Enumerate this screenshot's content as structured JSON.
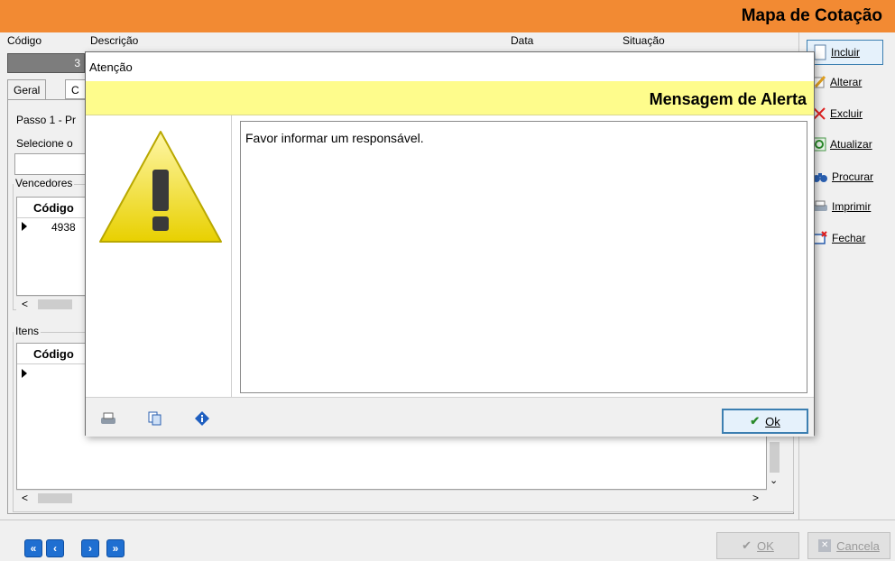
{
  "window": {
    "title": "Mapa de Cotação"
  },
  "header_fields": {
    "codigo_label": "Código",
    "codigo_value": "3",
    "descricao_label": "Descrição",
    "data_label": "Data",
    "situacao_label": "Situação"
  },
  "tabs": [
    {
      "label": "Geral"
    },
    {
      "label": "C"
    }
  ],
  "panel": {
    "passo": "Passo 1 - Pr",
    "selecione": "Selecione o",
    "vencedores_title": "Vencedores",
    "vencedores_col": "Código",
    "vencedores_row_code": "4938",
    "itens_title": "Itens",
    "itens_col": "Código"
  },
  "sidebar": {
    "buttons": [
      {
        "label": "Incluir",
        "icon": "new-document-icon"
      },
      {
        "label": "Alterar",
        "icon": "edit-pencil-icon"
      },
      {
        "label": "Excluir",
        "icon": "delete-x-icon"
      },
      {
        "label": "Atualizar",
        "icon": "refresh-icon"
      },
      {
        "label": "Procurar",
        "icon": "binoculars-icon"
      },
      {
        "label": "Imprimir",
        "icon": "printer-icon"
      },
      {
        "label": "Fechar",
        "icon": "exit-icon"
      }
    ]
  },
  "bottom": {
    "nav": [
      "«",
      "‹",
      "›",
      "»"
    ],
    "ok_label": "OK",
    "cancel_label": "Cancela"
  },
  "dialog": {
    "title": "Atenção",
    "header": "Mensagem de Alerta",
    "message": "Favor informar um responsável.",
    "ok_label": "Ok",
    "band_color": "#fefc8c"
  },
  "colors": {
    "accent": "#f28a33",
    "nav_blue": "#1f6fd1"
  }
}
